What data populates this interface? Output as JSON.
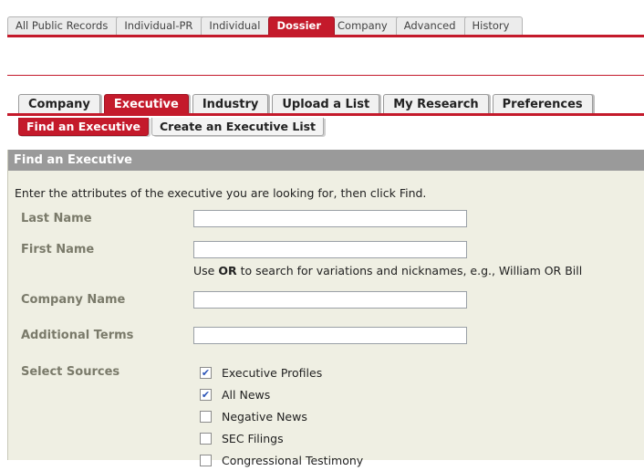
{
  "top_tabs": [
    "All Public Records",
    "Individual-PR",
    "Individual",
    "Dossier",
    "Company",
    "Advanced",
    "History"
  ],
  "top_active": "Dossier",
  "dossier_tabs": [
    "Company",
    "Executive",
    "Industry",
    "Upload a List",
    "My Research",
    "Preferences"
  ],
  "dossier_active": "Executive",
  "sub_tabs": [
    "Find an Executive",
    "Create an Executive List"
  ],
  "sub_active": "Find an Executive",
  "panel": {
    "title": "Find an Executive",
    "intro": "Enter the attributes of the executive you are looking for, then click Find.",
    "last_name": {
      "label": "Last Name",
      "value": ""
    },
    "first_name": {
      "label": "First Name",
      "value": ""
    },
    "hint_pre": "Use ",
    "hint_or": "OR",
    "hint_post": " to search for variations and nicknames, e.g., William OR Bill",
    "company_name": {
      "label": "Company Name",
      "value": ""
    },
    "additional_terms": {
      "label": "Additional Terms",
      "value": ""
    },
    "sources_label": "Select Sources",
    "sources": [
      {
        "label": "Executive Profiles",
        "checked": true
      },
      {
        "label": "All News",
        "checked": true
      },
      {
        "label": "Negative News",
        "checked": false
      },
      {
        "label": "SEC Filings",
        "checked": false
      },
      {
        "label": "Congressional Testimony",
        "checked": false
      }
    ]
  },
  "colors": {
    "accent": "#c41a2b",
    "panel_bg": "#efefe3",
    "header_bg": "#9a9a9a"
  }
}
